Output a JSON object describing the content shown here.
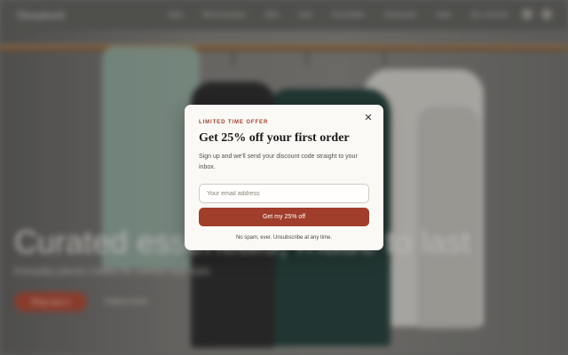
{
  "storefront": {
    "brand": "Threadwell",
    "nav_links": [
      "New",
      "Womenswear",
      "Men",
      "Kids",
      "Essentials",
      "Outerwear",
      "Sale",
      "Our Journal"
    ],
    "hero_title": "Curated essentials, made to last",
    "hero_subtitle": "Everyday pieces crafted for comfort and style.",
    "hero_cta": "Shop new in",
    "hero_link": "Explore more"
  },
  "modal": {
    "eyebrow": "LIMITED TIME OFFER",
    "headline": "Get 25% off your first order",
    "body": "Sign up and we'll send your discount code straight to your inbox.",
    "email_placeholder": "Your email address",
    "submit_label": "Get my 25% off",
    "fine_print": "No spam, ever. Unsubscribe at any time.",
    "close_glyph": "✕",
    "accent_color": "#a13d2b"
  }
}
